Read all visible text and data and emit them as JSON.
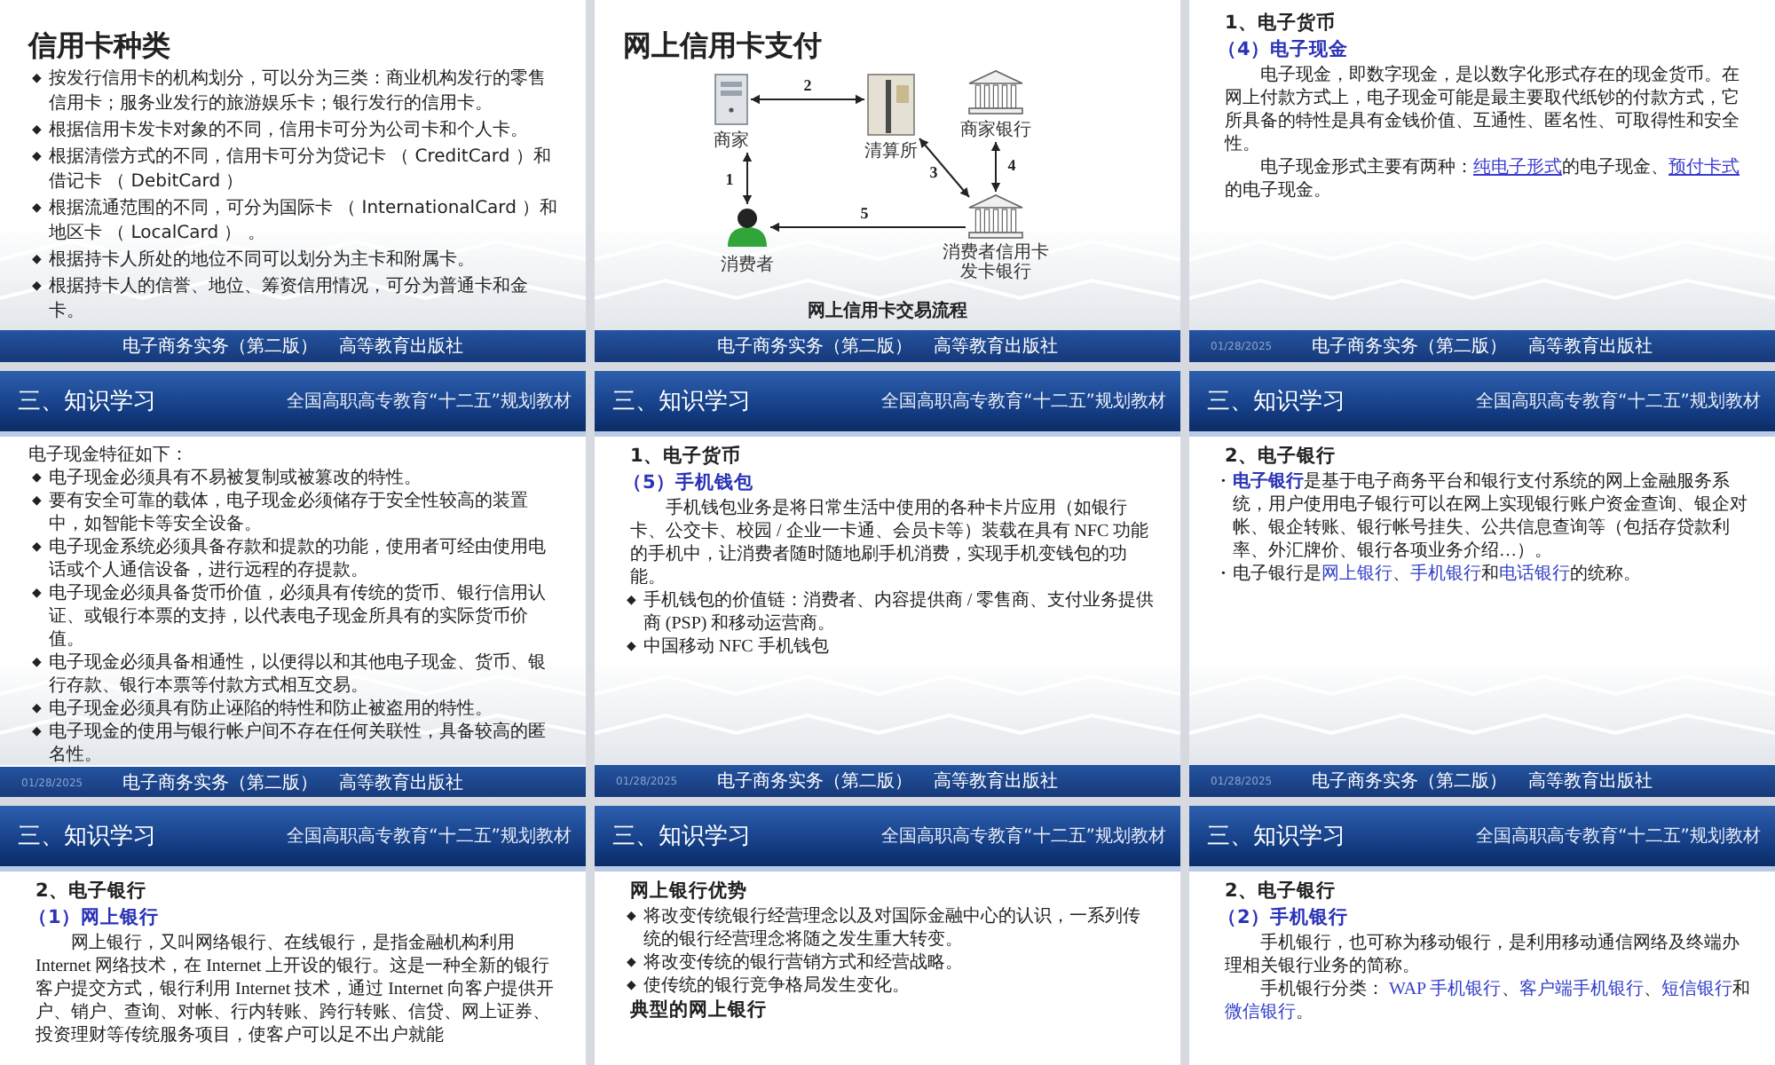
{
  "slides": [
    {
      "blocks": [
        {
          "kind": "title",
          "text": "信用卡种类"
        },
        {
          "kind": "bullet",
          "marker": "◆",
          "text": "按发行信用卡的机构划分，可以分为三类：商业机构发行的零售信用卡；服务业发行的旅游娱乐卡；银行发行的信用卡。"
        },
        {
          "kind": "bullet",
          "marker": "◆",
          "text": "根据信用卡发卡对象的不同，信用卡可分为公司卡和个人卡。"
        },
        {
          "kind": "bullet",
          "marker": "◆",
          "text": "根据清偿方式的不同，信用卡可分为贷记卡 （ CreditCard ）和借记卡 （ DebitCard ）"
        },
        {
          "kind": "bullet",
          "marker": "◆",
          "text": "根据流通范围的不同，可分为国际卡 （ InternationalCard ）和地区卡 （ LocalCard ） 。"
        },
        {
          "kind": "bullet",
          "marker": "◆",
          "text": "根据持卡人所处的地位不同可以划分为主卡和附属卡。"
        },
        {
          "kind": "bullet",
          "marker": "◆",
          "text": "根据持卡人的信誉、地位、筹资信用情况，可分为普通卡和金卡。"
        }
      ],
      "footer": {
        "book": "电子商务实务（第二版）",
        "publisher": "高等教育出版社"
      }
    },
    {
      "blocks": [
        {
          "kind": "title",
          "text": "网上信用卡支付"
        },
        {
          "kind": "diagram",
          "nodes": [
            {
              "kind": "server",
              "lines": [
                "商家"
              ]
            },
            {
              "kind": "clearing",
              "lines": [
                "清算所"
              ]
            },
            {
              "kind": "bank",
              "lines": [
                "商家银行"
              ]
            },
            {
              "kind": "person",
              "lines": [
                "消费者"
              ]
            },
            {
              "kind": "bank",
              "lines": [
                "消费者信用卡",
                "发卡银行"
              ]
            }
          ],
          "edges": [
            {
              "label": "1",
              "bidirectional": true
            },
            {
              "label": "2",
              "bidirectional": true
            },
            {
              "label": "3",
              "bidirectional": true
            },
            {
              "label": "4",
              "bidirectional": true
            },
            {
              "label": "5",
              "bidirectional": false
            }
          ]
        }
      ],
      "caption": "网上信用卡交易流程",
      "footer": {
        "book": "电子商务实务（第二版）",
        "publisher": "高等教育出版社"
      }
    },
    {
      "blocks": [
        {
          "kind": "heading",
          "text": "1、电子货币"
        },
        {
          "kind": "subheading",
          "text": "（4）电子现金"
        },
        {
          "kind": "para",
          "text": "电子现金，即数字现金，是以数字化形式存在的现金货币。在网上付款方式上，电子现金可能是最主要取代纸钞的付款方式，它所具备的特性是具有金钱价值、互通性、匿名性、可取得性和安全性。"
        },
        {
          "kind": "para",
          "parts": [
            {
              "kind": "plain",
              "text": "电子现金形式主要有两种："
            },
            {
              "kind": "link",
              "text": "纯电子形式"
            },
            {
              "kind": "plain",
              "text": "的电子现金、"
            },
            {
              "kind": "link",
              "text": "预付卡式"
            },
            {
              "kind": "plain",
              "text": "的电子现金。"
            }
          ]
        }
      ],
      "footer": {
        "date": "01/28/2025",
        "book": "电子商务实务（第二版）",
        "publisher": "高等教育出版社"
      }
    },
    {
      "header": {
        "title": "三、知识学习",
        "series": "全国高职高专教育“十二五”规划教材"
      },
      "blocks": [
        {
          "kind": "plain",
          "text": "电子现金特征如下："
        },
        {
          "kind": "bullet",
          "marker": "◆",
          "text": "电子现金必须具有不易被复制或被篡改的特性。"
        },
        {
          "kind": "bullet",
          "marker": "◆",
          "text": "要有安全可靠的载体，电子现金必须储存于安全性较高的装置中，如智能卡等安全设备。"
        },
        {
          "kind": "bullet",
          "marker": "◆",
          "text": "电子现金系统必须具备存款和提款的功能，使用者可经由使用电话或个人通信设备，进行远程的存提款。"
        },
        {
          "kind": "bullet",
          "marker": "◆",
          "text": "电子现金必须具备货币价值，必须具有传统的货币、银行信用认证、或银行本票的支持，以代表电子现金所具有的实际货币价值。"
        },
        {
          "kind": "bullet",
          "marker": "◆",
          "text": "电子现金必须具备相通性，以便得以和其他电子现金、货币、银行存款、银行本票等付款方式相互交易。"
        },
        {
          "kind": "bullet",
          "marker": "◆",
          "text": "电子现金必须具有防止诬陷的特性和防止被盗用的特性。"
        },
        {
          "kind": "bullet",
          "marker": "◆",
          "text": "电子现金的使用与银行帐户间不存在任何关联性，具备较高的匿名性。"
        }
      ],
      "footer": {
        "date": "01/28/2025",
        "book": "电子商务实务（第二版）",
        "publisher": "高等教育出版社"
      }
    },
    {
      "header": {
        "title": "三、知识学习",
        "series": "全国高职高专教育“十二五”规划教材"
      },
      "blocks": [
        {
          "kind": "heading",
          "text": "1、电子货币"
        },
        {
          "kind": "subheading",
          "text": "（5）手机钱包"
        },
        {
          "kind": "para",
          "text": "手机钱包业务是将日常生活中使用的各种卡片应用（如银行卡、公交卡、校园 / 企业一卡通、会员卡等）装载在具有 NFC 功能的手机中，让消费者随时随地刷手机消费，实现手机变钱包的功能。"
        },
        {
          "kind": "bullet",
          "marker": "◆",
          "text": "手机钱包的价值链：消费者、内容提供商 / 零售商、支付业务提供商 (PSP) 和移动运营商。"
        },
        {
          "kind": "bullet",
          "marker": "◆",
          "text": "中国移动 NFC 手机钱包"
        }
      ],
      "footer": {
        "date": "01/28/2025",
        "book": "电子商务实务（第二版）",
        "publisher": "高等教育出版社"
      }
    },
    {
      "header": {
        "title": "三、知识学习",
        "series": "全国高职高专教育“十二五”规划教材"
      },
      "blocks": [
        {
          "kind": "heading",
          "text": "2、电子银行"
        },
        {
          "kind": "bullet",
          "marker": "•",
          "parts": [
            {
              "kind": "accent_bold",
              "text": "电子银行"
            },
            {
              "kind": "plain",
              "text": "是基于电子商务平台和银行支付系统的网上金融服务系统，用户使用电子银行可以在网上实现银行账户资金查询、银企对帐、银企转账、银行帐号挂失、公共信息查询等（包括存贷款利率、外汇牌价、银行各项业务介绍…）。"
            }
          ]
        },
        {
          "kind": "bullet",
          "marker": "•",
          "parts": [
            {
              "kind": "plain",
              "text": "电子银行是"
            },
            {
              "kind": "accent",
              "text": "网上银行"
            },
            {
              "kind": "plain",
              "text": "、"
            },
            {
              "kind": "accent",
              "text": "手机银行"
            },
            {
              "kind": "plain",
              "text": "和"
            },
            {
              "kind": "accent",
              "text": "电话银行"
            },
            {
              "kind": "plain",
              "text": "的统称。"
            }
          ]
        }
      ],
      "footer": {
        "date": "01/28/2025",
        "book": "电子商务实务（第二版）",
        "publisher": "高等教育出版社"
      }
    },
    {
      "header": {
        "title": "三、知识学习",
        "series": "全国高职高专教育“十二五”规划教材"
      },
      "blocks": [
        {
          "kind": "heading",
          "text": "2、电子银行"
        },
        {
          "kind": "subheading",
          "text": "（1）网上银行"
        },
        {
          "kind": "para",
          "text": "网上银行，又叫网络银行、在线银行，是指金融机构利用 Internet 网络技术，在 Internet 上开设的银行。这是一种全新的银行客户提交方式，银行利用 Internet 技术，通过 Internet 向客户提供开户、销户、查询、对帐、行内转账、跨行转账、信贷、网上证券、投资理财等传统服务项目，使客户可以足不出户就能"
        }
      ]
    },
    {
      "header": {
        "title": "三、知识学习",
        "series": "全国高职高专教育“十二五”规划教材"
      },
      "blocks": [
        {
          "kind": "heading",
          "text": "网上银行优势"
        },
        {
          "kind": "bullet",
          "marker": "◆",
          "text": "将改变传统银行经营理念以及对国际金融中心的认识，一系列传统的银行经营理念将随之发生重大转变。"
        },
        {
          "kind": "bullet",
          "marker": "◆",
          "text": "将改变传统的银行营销方式和经营战略。"
        },
        {
          "kind": "bullet",
          "marker": "◆",
          "text": "使传统的银行竞争格局发生变化。"
        },
        {
          "kind": "heading",
          "text": "典型的网上银行"
        }
      ]
    },
    {
      "header": {
        "title": "三、知识学习",
        "series": "全国高职高专教育“十二五”规划教材"
      },
      "blocks": [
        {
          "kind": "heading",
          "text": "2、电子银行"
        },
        {
          "kind": "subheading",
          "text": "（2）手机银行"
        },
        {
          "kind": "para",
          "text": "手机银行，也可称为移动银行，是利用移动通信网络及终端办理相关银行业务的简称。"
        },
        {
          "kind": "para",
          "parts": [
            {
              "kind": "plain",
              "text": "手机银行分类： "
            },
            {
              "kind": "accent",
              "text": "WAP 手机银行"
            },
            {
              "kind": "plain",
              "text": "、"
            },
            {
              "kind": "accent",
              "text": "客户端手机银行"
            },
            {
              "kind": "plain",
              "text": "、"
            },
            {
              "kind": "accent",
              "text": "短信银行"
            },
            {
              "kind": "plain",
              "text": "和"
            },
            {
              "kind": "accent",
              "text": "微信银行"
            },
            {
              "kind": "plain",
              "text": "。"
            }
          ]
        }
      ]
    }
  ]
}
